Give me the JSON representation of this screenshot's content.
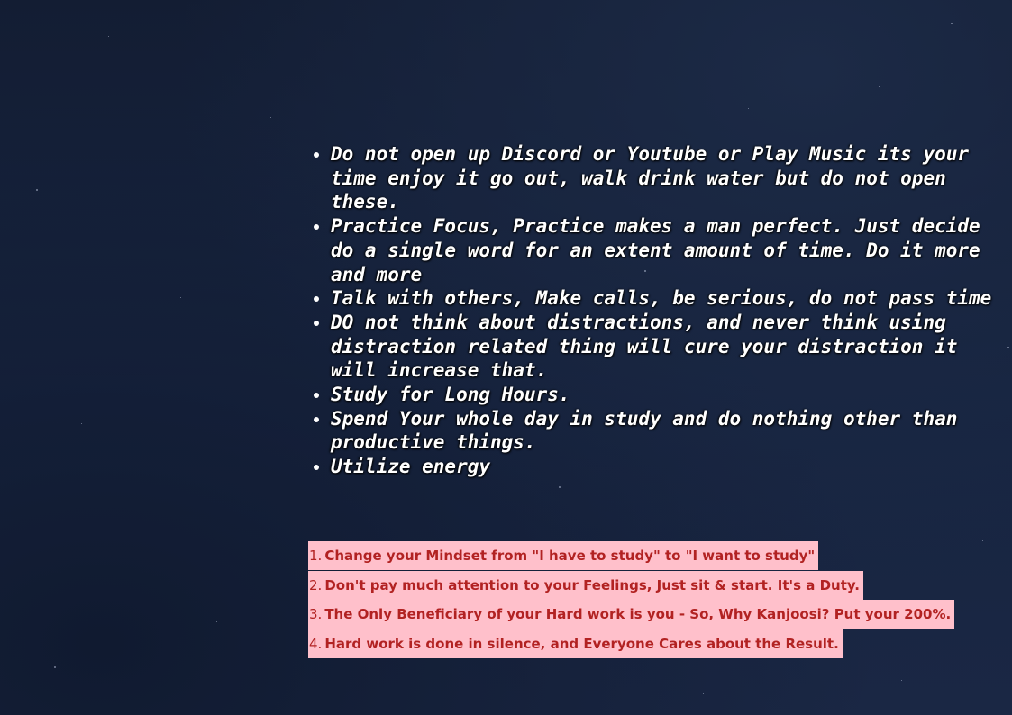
{
  "tips": [
    "Do not open up Discord or Youtube or Play Music its your time enjoy it go out, walk drink water but do not open these.",
    "Practice Focus, Practice makes a man perfect. Just decide do a single word for an extent amount of time. Do it more and more",
    "Talk with others, Make calls, be serious, do not pass time",
    "DO not think about distractions, and never think using distraction related thing will cure your distraction it will increase that.",
    "Study for Long Hours.",
    "Spend Your whole day in study and do nothing other than productive things.",
    "Utilize energy"
  ],
  "rules": [
    {
      "num": "1.",
      "text": "Change your Mindset from \"I have to study\" to \"I want to study\""
    },
    {
      "num": "2.",
      "text": "Don't pay much attention to your Feelings, Just sit & start. It's a Duty."
    },
    {
      "num": "3.",
      "text": "The Only Beneficiary of your Hard work is you - So, Why Kanjoosi? Put your 200%."
    },
    {
      "num": "4.",
      "text": "Hard work is done in silence, and Everyone Cares about the Result."
    }
  ],
  "colors": {
    "background": "#172440",
    "tip_text": "#ffffff",
    "rule_background": "#ffc0cb",
    "rule_text": "#b22222"
  }
}
